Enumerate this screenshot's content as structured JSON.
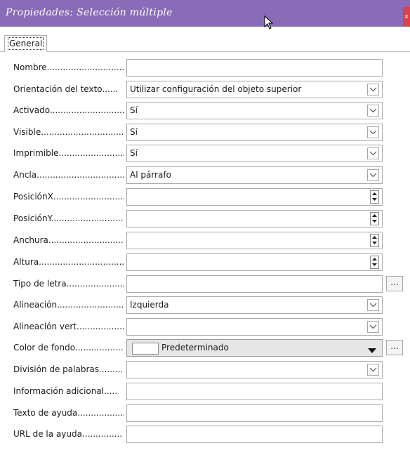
{
  "window": {
    "title": "Propiedades: Selección múltiple",
    "close_label": "x"
  },
  "tabs": [
    {
      "label": "General"
    }
  ],
  "fields": [
    {
      "label": "Nombre.............................",
      "type": "text",
      "value": ""
    },
    {
      "label": "Orientación del texto......",
      "type": "dropdown",
      "value": "Utilizar configuración del objeto superior"
    },
    {
      "label": "Activado.............................",
      "type": "dropdown",
      "value": "Sí"
    },
    {
      "label": "Visible..................................",
      "type": "dropdown",
      "value": "Sí"
    },
    {
      "label": "Imprimible.........................",
      "type": "dropdown",
      "value": "Sí"
    },
    {
      "label": "Ancla...................................",
      "type": "dropdown",
      "value": "Al párrafo"
    },
    {
      "label": "PosiciónX...........................",
      "type": "spin",
      "value": ""
    },
    {
      "label": "PosiciónY...........................",
      "type": "spin",
      "value": ""
    },
    {
      "label": "Anchura...............................",
      "type": "spin",
      "value": ""
    },
    {
      "label": "Altura....................................",
      "type": "spin",
      "value": ""
    },
    {
      "label": "Tipo de letra.......................",
      "type": "text-button",
      "value": "",
      "button_label": "..."
    },
    {
      "label": "Alineación...........................",
      "type": "dropdown",
      "value": "Izquierda"
    },
    {
      "label": "Alineación vert..................",
      "type": "dropdown",
      "value": ""
    },
    {
      "label": "Color de fondo..................",
      "type": "color",
      "value": "Predeterminado",
      "button_label": "..."
    },
    {
      "label": "División de palabras.........",
      "type": "dropdown",
      "value": ""
    },
    {
      "label": "Información adicional.....",
      "type": "text",
      "value": ""
    },
    {
      "label": "Texto de ayuda..................",
      "type": "text",
      "value": ""
    },
    {
      "label": "URL de la ayuda...............",
      "type": "text",
      "value": ""
    }
  ],
  "colors": {
    "titlebar": "#8a6bb8",
    "close_button": "#d8434e"
  },
  "icons": {
    "dropdown": "chevron-down-icon",
    "spin_up": "spin-up-icon",
    "spin_down": "spin-down-icon",
    "color_dropdown": "triangle-down-icon",
    "cursor": "mouse-pointer-icon"
  }
}
